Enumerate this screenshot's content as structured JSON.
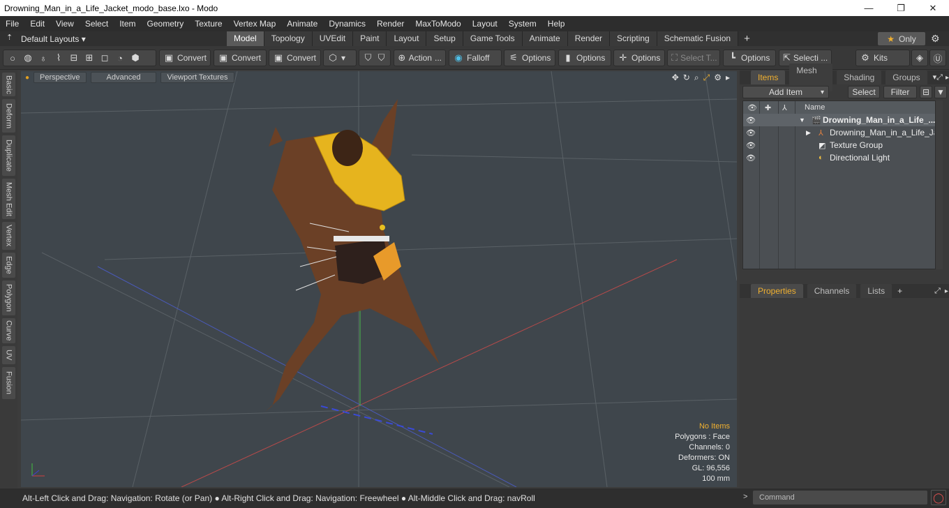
{
  "window": {
    "title": "Drowning_Man_in_a_Life_Jacket_modo_base.lxo - Modo",
    "minimize": "—",
    "maximize": "❐",
    "close": "✕"
  },
  "menu": [
    "File",
    "Edit",
    "View",
    "Select",
    "Item",
    "Geometry",
    "Texture",
    "Vertex Map",
    "Animate",
    "Dynamics",
    "Render",
    "MaxToModo",
    "Layout",
    "System",
    "Help"
  ],
  "layouts": {
    "label": "Default Layouts ▾",
    "tabs": [
      "Model",
      "Topology",
      "UVEdit",
      "Paint",
      "Layout",
      "Setup",
      "Game Tools",
      "Animate",
      "Render",
      "Scripting",
      "Schematic Fusion"
    ],
    "active": "Model",
    "plus": "+",
    "only": "Only",
    "star": "★",
    "gear": "⚙"
  },
  "toolbar": {
    "convert1": "Convert",
    "convert2": "Convert",
    "convert3": "Convert",
    "action": "Action",
    "action_more": "...",
    "falloff": "Falloff",
    "options1": "Options",
    "options2": "Options",
    "options3": "Options",
    "select_t": "Select T...",
    "options4": "Options",
    "selecti": "Selecti ...",
    "kits": "Kits"
  },
  "side_tabs": [
    "Basic",
    "Deform",
    "Duplicate",
    "Mesh Edit",
    "Vertex",
    "Edge",
    "Polygon",
    "Curve",
    "UV",
    "Fusion"
  ],
  "viewport": {
    "perspective": "Perspective",
    "advanced": "Advanced",
    "textures": "Viewport Textures",
    "info": {
      "items": "No Items",
      "polygons": "Polygons : Face",
      "channels": "Channels: 0",
      "deformers": "Deformers: ON",
      "gl": "GL: 96,556",
      "scale": "100 mm"
    }
  },
  "status": "Alt-Left Click and Drag: Navigation: Rotate (or Pan) ● Alt-Right Click and Drag: Navigation: Freewheel ● Alt-Middle Click and Drag: navRoll",
  "items_panel": {
    "tabs": [
      "Items",
      "Mesh ...",
      "Shading",
      "Groups"
    ],
    "add_item": "Add Item",
    "select": "Select",
    "filter": "Filter",
    "col_name": "Name",
    "rows": [
      {
        "label": "Drowning_Man_in_a_Life_...",
        "bold": true
      },
      {
        "label": "Drowning_Man_in_a_Life_Ja..."
      },
      {
        "label": "Texture Group"
      },
      {
        "label": "Directional Light"
      }
    ]
  },
  "props_panel": {
    "tabs": [
      "Properties",
      "Channels",
      "Lists"
    ],
    "plus": "+"
  },
  "command": {
    "placeholder": "Command"
  }
}
